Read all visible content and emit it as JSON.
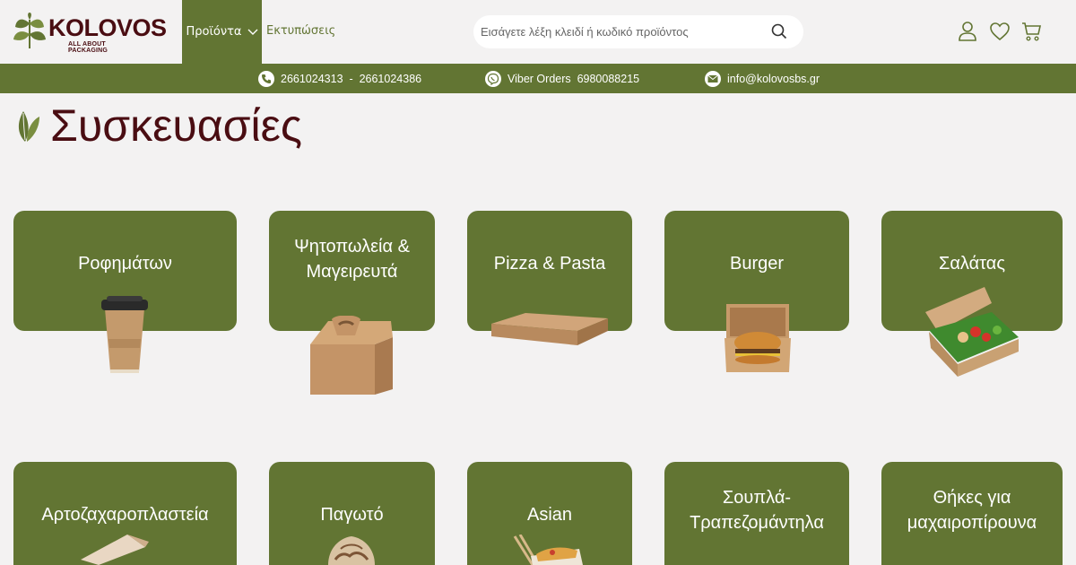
{
  "brand": {
    "name": "KOLOVOS",
    "tagline": "ALL ABOUT PACKAGING",
    "primary_color": "#627533",
    "title_color": "#4a0d12",
    "background_color": "#f3f2f2"
  },
  "nav": {
    "items": [
      {
        "label": "Προϊόντα",
        "active": true,
        "icon": "chevron-down-icon"
      },
      {
        "label": "Εκτυπώσεις",
        "active": false
      }
    ]
  },
  "search": {
    "placeholder": "Εισάγετε λέξη κλειδί ή κωδικό προϊόντος",
    "icon": "search-icon"
  },
  "header_icons": [
    "user-icon",
    "heart-icon",
    "cart-icon"
  ],
  "contact_bar": {
    "phone": {
      "icon": "phone-icon",
      "text": "2661024313  -  2661024386"
    },
    "viber": {
      "icon": "viber-icon",
      "text": "Viber Orders  6980088215"
    },
    "email": {
      "icon": "email-icon",
      "text": "info@kolovosbs.gr"
    }
  },
  "page": {
    "title": "Συσκευασίες",
    "title_icon": "leaf-icon"
  },
  "categories": [
    {
      "label": "Ροφημάτων",
      "image": "paper-coffee-cup"
    },
    {
      "label": "Ψητοπωλεία & Μαγειρευτά",
      "image": "kraft-handle-box"
    },
    {
      "label": "Pizza & Pasta",
      "image": "kraft-pizza-box"
    },
    {
      "label": "Burger",
      "image": "burger-box"
    },
    {
      "label": "Σαλάτας",
      "image": "salad-box"
    },
    {
      "label": "Αρτοζαχαροπλαστεία",
      "image": "pastry-box"
    },
    {
      "label": "Παγωτό",
      "image": "ice-cream-cup"
    },
    {
      "label": "Asian",
      "image": "noodle-box"
    },
    {
      "label": "Σουπλά-Τραπεζομάντηλα",
      "image": "placemats"
    },
    {
      "label": "Θήκες για μαχαιροπίρουνα",
      "image": "cutlery-sleeves"
    }
  ]
}
